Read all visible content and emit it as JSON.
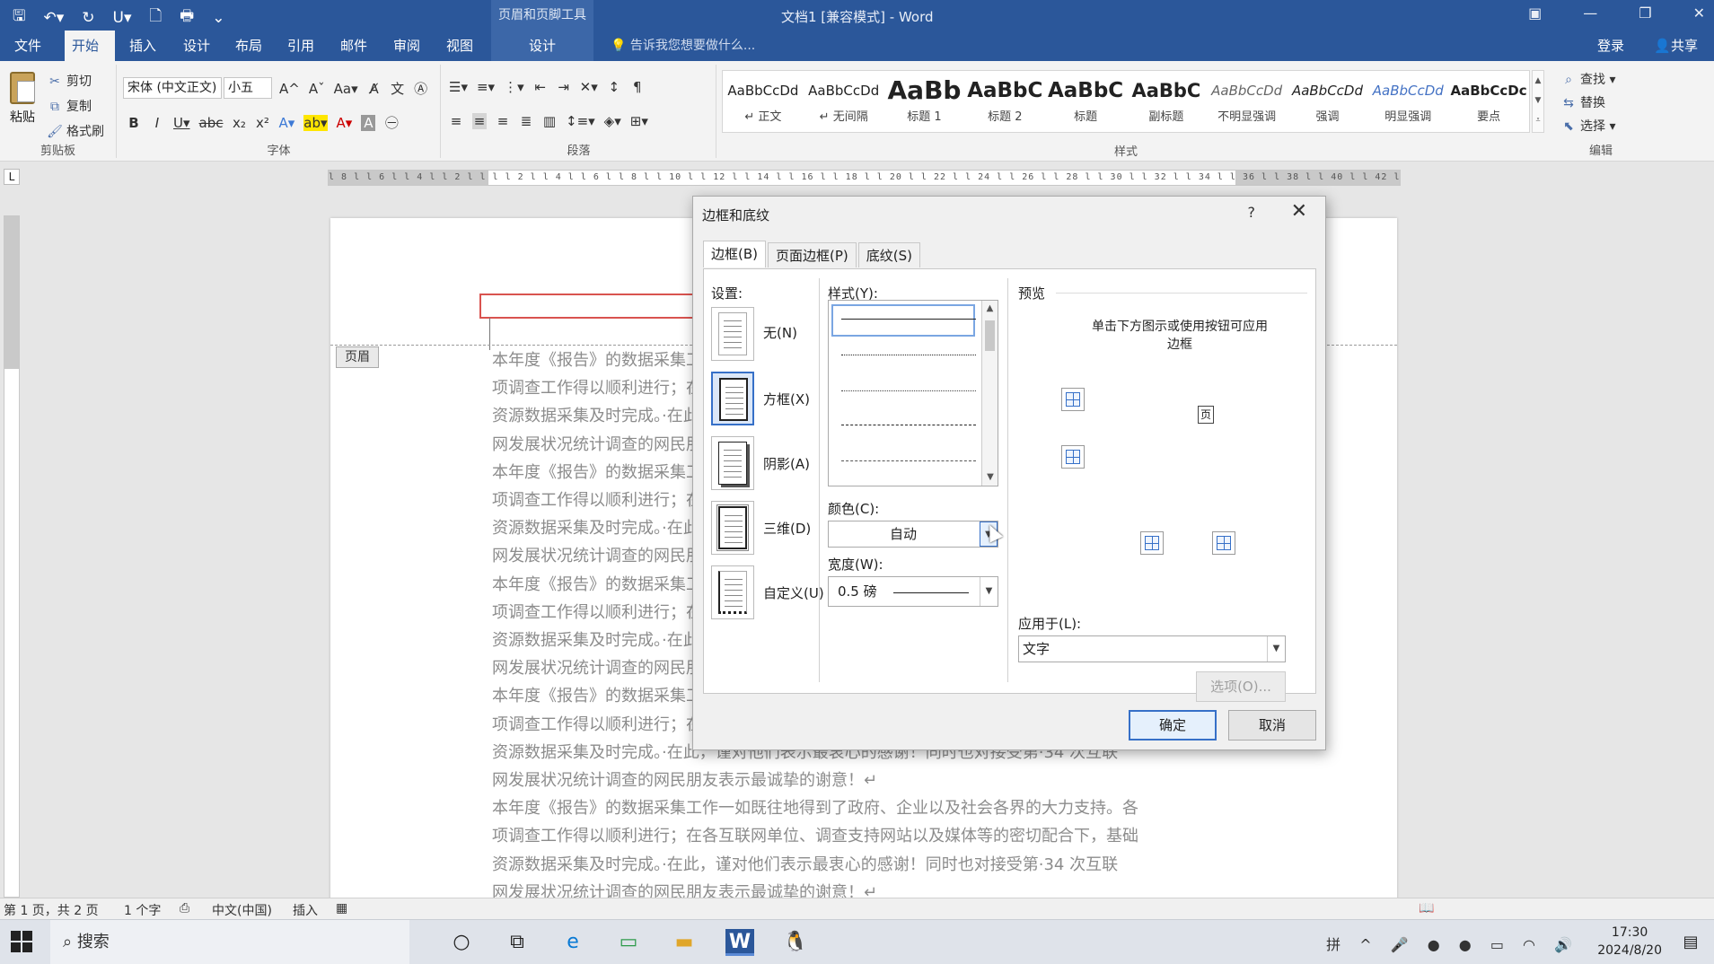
{
  "titlebar": {
    "context_tools": "页眉和页脚工具",
    "doc_title": "文档1 [兼容模式] - Word"
  },
  "tabs": {
    "items": [
      "文件",
      "开始",
      "插入",
      "设计",
      "布局",
      "引用",
      "邮件",
      "审阅",
      "视图",
      "设计"
    ],
    "active": "开始",
    "tell_me": "告诉我您想要做什么...",
    "login": "登录",
    "share": "共享"
  },
  "ribbon": {
    "clipboard": {
      "paste": "粘贴",
      "cut": "剪切",
      "copy": "复制",
      "format_painter": "格式刷",
      "label": "剪贴板"
    },
    "font": {
      "name": "宋体 (中文正文)",
      "size": "小五",
      "label": "字体"
    },
    "paragraph": {
      "label": "段落"
    },
    "styles": {
      "label": "样式",
      "items": [
        {
          "sample": "AaBbCcDd",
          "name": "↵ 正文"
        },
        {
          "sample": "AaBbCcDd",
          "name": "↵ 无间隔"
        },
        {
          "sample": "AaBb",
          "name": "标题 1"
        },
        {
          "sample": "AaBbC",
          "name": "标题 2"
        },
        {
          "sample": "AaBbC",
          "name": "标题"
        },
        {
          "sample": "AaBbC",
          "name": "副标题"
        },
        {
          "sample": "AaBbCcDd",
          "name": "不明显强调"
        },
        {
          "sample": "AaBbCcDd",
          "name": "强调"
        },
        {
          "sample": "AaBbCcDd",
          "name": "明显强调"
        },
        {
          "sample": "AaBbCcDc",
          "name": "要点"
        }
      ]
    },
    "editing": {
      "find": "查找",
      "replace": "替换",
      "select": "选择",
      "label": "编辑"
    }
  },
  "ruler": {
    "h_text": "l 8 l l 6 l l 4 l l 2 l l l l 2 l l 4 l l 6 l l 8 l l 10 l l 12 l l 14 l l 16 l l 18 l l 20 l l 22 l l 24 l l 26 l l 28 l l 30 l l 32 l l 34 l l 36 l l 38 l l 40 l l 42 l l 44 l l 46 l l 48"
  },
  "document": {
    "header_tag": "页眉",
    "paragraph_lines": [
      "本年度《报告》的数据采集工作一如既往地得到了政府、企业以及社会各界的大力支持。各",
      "项调查工作得以顺利进行；在各互联网单位、调查支持网站以及媒体等的密切配合下，基础",
      "资源数据采集及时完成。·在此，谨对他们表示最衷心的感谢！同时也对接受第·34 次互联",
      "网发展状况统计调查的网民朋友表示最诚挚的谢意！↵"
    ],
    "repeat": 5
  },
  "dialog": {
    "title": "边框和底纹",
    "help": "?",
    "tabs": [
      "边框(B)",
      "页面边框(P)",
      "底纹(S)"
    ],
    "settings_label": "设置:",
    "settings": [
      "无(N)",
      "方框(X)",
      "阴影(A)",
      "三维(D)",
      "自定义(U)"
    ],
    "style_label": "样式(Y):",
    "color_label": "颜色(C):",
    "color_value": "自动",
    "width_label": "宽度(W):",
    "width_value": "0.5 磅",
    "preview_label": "预览",
    "preview_hint": "单击下方图示或使用按钮可应用边框",
    "preview_page": "页",
    "apply_label": "应用于(L):",
    "apply_value": "文字",
    "options": "选项(O)...",
    "ok": "确定",
    "cancel": "取消"
  },
  "statusbar": {
    "page": "第 1 页，共 2 页",
    "words": "1 个字",
    "lang": "中文(中国)",
    "mode": "插入"
  },
  "taskbar": {
    "search": "搜索",
    "ime": "拼",
    "time": "17:30",
    "date": "2024/8/20"
  },
  "colors": {
    "word_blue": "#2b579a",
    "header_border": "#d9534f",
    "accent": "#3670c8"
  }
}
